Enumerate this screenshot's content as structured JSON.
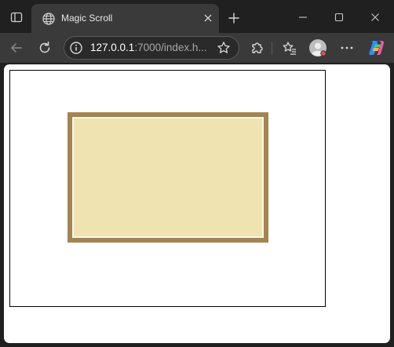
{
  "browser": {
    "tab": {
      "title": "Magic Scroll",
      "favicon": "globe-icon"
    },
    "address_bar": {
      "host": "127.0.0.1",
      "path_visible": ":7000/index.h...",
      "info_icon": "info-icon",
      "favorite_icon": "star-icon"
    },
    "toolbar_icons": {
      "back": "back-arrow-icon",
      "reload": "reload-icon",
      "extensions": "puzzle-icon",
      "favorites": "favorites-icon",
      "profile": "avatar-icon",
      "more": "more-icon",
      "copilot": "copilot-icon"
    },
    "window_controls": [
      "minimize-icon",
      "maximize-icon",
      "close-icon"
    ]
  },
  "page": {
    "scroll": {
      "message": "",
      "colors": {
        "frame": "#a38452",
        "border": "#fbf7ec",
        "parchment": "#efe3b1"
      }
    },
    "canvas_border_color": "#000000"
  }
}
